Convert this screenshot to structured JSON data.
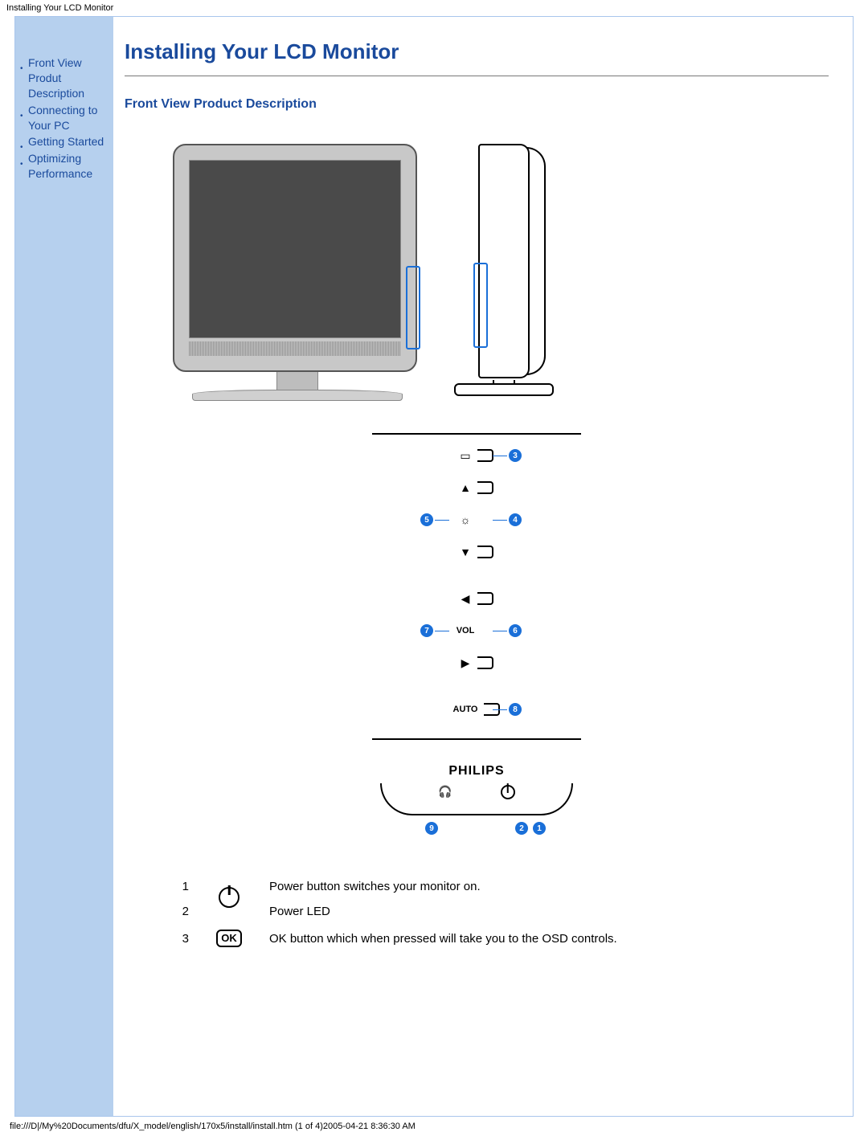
{
  "header": {
    "title": "Installing Your LCD Monitor"
  },
  "sidebar": {
    "items": [
      {
        "label": "Front View Produt Description"
      },
      {
        "label": "Connecting to Your PC"
      },
      {
        "label": "Getting Started"
      },
      {
        "label": "Optimizing Performance"
      }
    ]
  },
  "main": {
    "h1": "Installing Your LCD Monitor",
    "h2": "Front View Product Description",
    "brand": "PHILIPS",
    "button_labels": {
      "auto": "AUTO",
      "vol": "VOL"
    },
    "callouts": {
      "b1": "1",
      "b2": "2",
      "b3": "3",
      "b4": "4",
      "b5": "5",
      "b6": "6",
      "b7": "7",
      "b8": "8",
      "b9": "9"
    },
    "legend": [
      {
        "num": "1",
        "icon": "power",
        "desc": "Power button switches your monitor on."
      },
      {
        "num": "2",
        "icon": "power",
        "desc": "Power LED"
      },
      {
        "num": "3",
        "icon": "ok",
        "desc": "OK button which when pressed will take you to the OSD controls."
      }
    ]
  },
  "footer": {
    "path": "file:///D|/My%20Documents/dfu/X_model/english/170x5/install/install.htm (1 of 4)2005-04-21 8:36:30 AM"
  }
}
